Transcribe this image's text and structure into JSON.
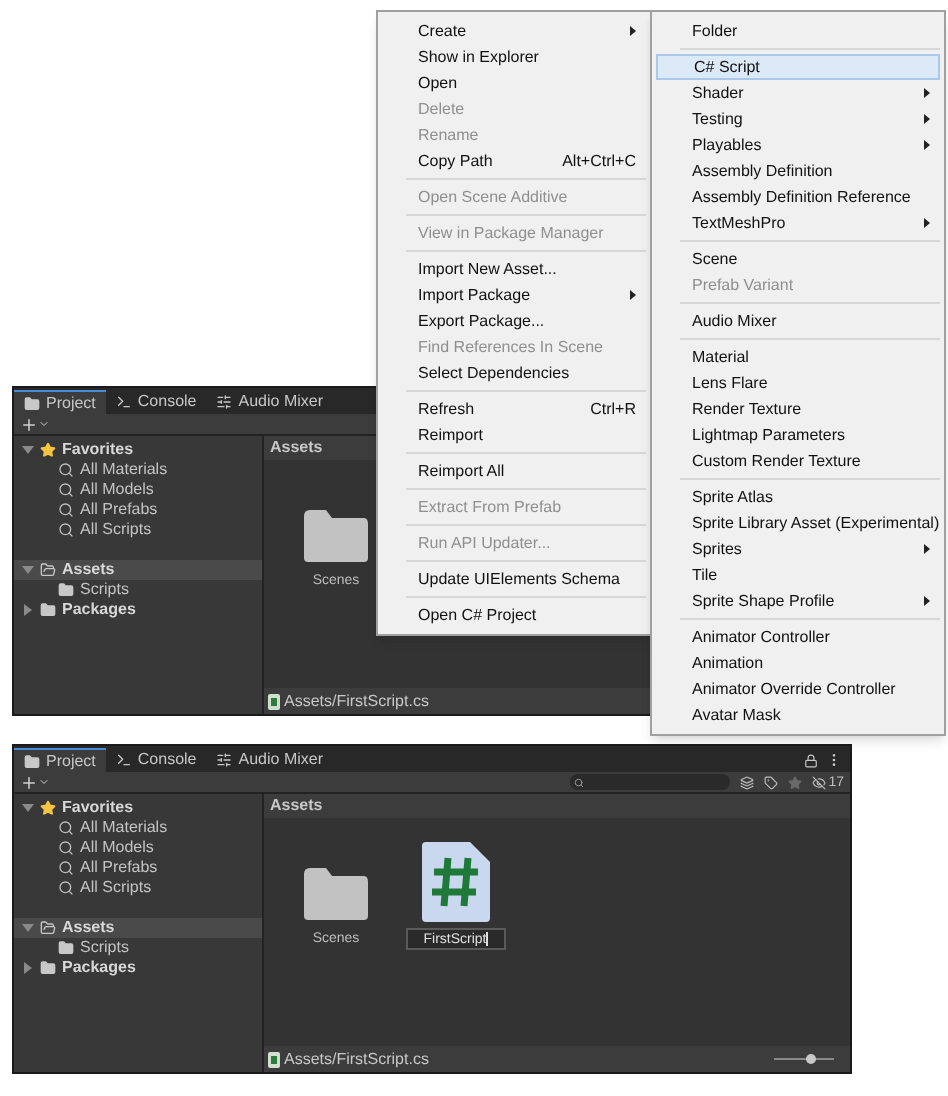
{
  "panels": [
    {
      "tabs": [
        {
          "label": "Project",
          "kind": "project",
          "selected": true
        },
        {
          "label": "Console",
          "kind": "console",
          "selected": false
        },
        {
          "label": "Audio Mixer",
          "kind": "mixer",
          "selected": false
        }
      ],
      "tree": [
        {
          "label": "Favorites",
          "kind": "star",
          "expanded": true,
          "selected": false,
          "children": [
            {
              "label": "All Materials",
              "kind": "search"
            },
            {
              "label": "All Models",
              "kind": "search"
            },
            {
              "label": "All Prefabs",
              "kind": "search"
            },
            {
              "label": "All Scripts",
              "kind": "search"
            }
          ]
        },
        {
          "label": "Assets",
          "kind": "folder",
          "expanded": true,
          "selected": true,
          "children": [
            {
              "label": "Scripts",
              "kind": "folder"
            }
          ]
        },
        {
          "label": "Packages",
          "kind": "folder",
          "expanded": false,
          "selected": false
        }
      ],
      "breadcrumb": "Assets",
      "assets": [
        {
          "kind": "folder",
          "label": "Scenes"
        }
      ],
      "status_path": "Assets/FirstScript.cs"
    },
    {
      "tabs": [
        {
          "label": "Project",
          "kind": "project",
          "selected": true
        },
        {
          "label": "Console",
          "kind": "console",
          "selected": false
        },
        {
          "label": "Audio Mixer",
          "kind": "mixer",
          "selected": false
        }
      ],
      "hidden_count": "17",
      "tree": [
        {
          "label": "Favorites",
          "kind": "star",
          "expanded": true,
          "selected": false,
          "children": [
            {
              "label": "All Materials",
              "kind": "search"
            },
            {
              "label": "All Models",
              "kind": "search"
            },
            {
              "label": "All Prefabs",
              "kind": "search"
            },
            {
              "label": "All Scripts",
              "kind": "search"
            }
          ]
        },
        {
          "label": "Assets",
          "kind": "folder",
          "expanded": true,
          "selected": true,
          "children": [
            {
              "label": "Scripts",
              "kind": "folder"
            }
          ]
        },
        {
          "label": "Packages",
          "kind": "folder",
          "expanded": false,
          "selected": false
        }
      ],
      "breadcrumb": "Assets",
      "assets": [
        {
          "kind": "folder",
          "label": "Scenes"
        },
        {
          "kind": "script",
          "label": "FirstScript",
          "renaming": true
        }
      ],
      "status_path": "Assets/FirstScript.cs",
      "zoom_slider": {
        "level": 0.6
      }
    }
  ],
  "context_menu": {
    "items": [
      {
        "kind": "item",
        "label": "Create",
        "disabled": false,
        "submenu": true
      },
      {
        "kind": "item",
        "label": "Show in Explorer",
        "disabled": false,
        "submenu": false
      },
      {
        "kind": "item",
        "label": "Open",
        "disabled": false,
        "submenu": false
      },
      {
        "kind": "item",
        "label": "Delete",
        "disabled": true,
        "submenu": false
      },
      {
        "kind": "item",
        "label": "Rename",
        "disabled": true,
        "submenu": false
      },
      {
        "kind": "item",
        "label": "Copy Path",
        "shortcut": "Alt+Ctrl+C",
        "disabled": false,
        "submenu": false
      },
      {
        "kind": "separator"
      },
      {
        "kind": "item",
        "label": "Open Scene Additive",
        "disabled": true,
        "submenu": false
      },
      {
        "kind": "separator"
      },
      {
        "kind": "item",
        "label": "View in Package Manager",
        "disabled": true,
        "submenu": false
      },
      {
        "kind": "separator"
      },
      {
        "kind": "item",
        "label": "Import New Asset...",
        "disabled": false,
        "submenu": false
      },
      {
        "kind": "item",
        "label": "Import Package",
        "disabled": false,
        "submenu": true
      },
      {
        "kind": "item",
        "label": "Export Package...",
        "disabled": false,
        "submenu": false
      },
      {
        "kind": "item",
        "label": "Find References In Scene",
        "disabled": true,
        "submenu": false
      },
      {
        "kind": "item",
        "label": "Select Dependencies",
        "disabled": false,
        "submenu": false
      },
      {
        "kind": "separator"
      },
      {
        "kind": "item",
        "label": "Refresh",
        "shortcut": "Ctrl+R",
        "disabled": false,
        "submenu": false
      },
      {
        "kind": "item",
        "label": "Reimport",
        "disabled": false,
        "submenu": false
      },
      {
        "kind": "separator"
      },
      {
        "kind": "item",
        "label": "Reimport All",
        "disabled": false,
        "submenu": false
      },
      {
        "kind": "separator"
      },
      {
        "kind": "item",
        "label": "Extract From Prefab",
        "disabled": true,
        "submenu": false
      },
      {
        "kind": "separator"
      },
      {
        "kind": "item",
        "label": "Run API Updater...",
        "disabled": true,
        "submenu": false
      },
      {
        "kind": "separator"
      },
      {
        "kind": "item",
        "label": "Update UIElements Schema",
        "disabled": false,
        "submenu": false
      },
      {
        "kind": "separator"
      },
      {
        "kind": "item",
        "label": "Open C# Project",
        "disabled": false,
        "submenu": false
      }
    ]
  },
  "create_submenu": {
    "items": [
      {
        "kind": "item",
        "label": "Folder",
        "disabled": false,
        "submenu": false,
        "selected": false
      },
      {
        "kind": "separator"
      },
      {
        "kind": "item",
        "label": "C# Script",
        "disabled": false,
        "submenu": false,
        "selected": true
      },
      {
        "kind": "item",
        "label": "Shader",
        "disabled": false,
        "submenu": true,
        "selected": false
      },
      {
        "kind": "item",
        "label": "Testing",
        "disabled": false,
        "submenu": true,
        "selected": false
      },
      {
        "kind": "item",
        "label": "Playables",
        "disabled": false,
        "submenu": true,
        "selected": false
      },
      {
        "kind": "item",
        "label": "Assembly Definition",
        "disabled": false,
        "submenu": false,
        "selected": false
      },
      {
        "kind": "item",
        "label": "Assembly Definition Reference",
        "disabled": false,
        "submenu": false,
        "selected": false
      },
      {
        "kind": "item",
        "label": "TextMeshPro",
        "disabled": false,
        "submenu": true,
        "selected": false
      },
      {
        "kind": "separator"
      },
      {
        "kind": "item",
        "label": "Scene",
        "disabled": false,
        "submenu": false,
        "selected": false
      },
      {
        "kind": "item",
        "label": "Prefab Variant",
        "disabled": true,
        "submenu": false,
        "selected": false
      },
      {
        "kind": "separator"
      },
      {
        "kind": "item",
        "label": "Audio Mixer",
        "disabled": false,
        "submenu": false,
        "selected": false
      },
      {
        "kind": "separator"
      },
      {
        "kind": "item",
        "label": "Material",
        "disabled": false,
        "submenu": false,
        "selected": false
      },
      {
        "kind": "item",
        "label": "Lens Flare",
        "disabled": false,
        "submenu": false,
        "selected": false
      },
      {
        "kind": "item",
        "label": "Render Texture",
        "disabled": false,
        "submenu": false,
        "selected": false
      },
      {
        "kind": "item",
        "label": "Lightmap Parameters",
        "disabled": false,
        "submenu": false,
        "selected": false
      },
      {
        "kind": "item",
        "label": "Custom Render Texture",
        "disabled": false,
        "submenu": false,
        "selected": false
      },
      {
        "kind": "separator"
      },
      {
        "kind": "item",
        "label": "Sprite Atlas",
        "disabled": false,
        "submenu": false,
        "selected": false
      },
      {
        "kind": "item",
        "label": "Sprite Library Asset (Experimental)",
        "disabled": false,
        "submenu": false,
        "selected": false
      },
      {
        "kind": "item",
        "label": "Sprites",
        "disabled": false,
        "submenu": true,
        "selected": false
      },
      {
        "kind": "item",
        "label": "Tile",
        "disabled": false,
        "submenu": false,
        "selected": false
      },
      {
        "kind": "item",
        "label": "Sprite Shape Profile",
        "disabled": false,
        "submenu": true,
        "selected": false
      },
      {
        "kind": "separator"
      },
      {
        "kind": "item",
        "label": "Animator Controller",
        "disabled": false,
        "submenu": false,
        "selected": false
      },
      {
        "kind": "item",
        "label": "Animation",
        "disabled": false,
        "submenu": false,
        "selected": false
      },
      {
        "kind": "item",
        "label": "Animator Override Controller",
        "disabled": false,
        "submenu": false,
        "selected": false
      },
      {
        "kind": "item",
        "label": "Avatar Mask",
        "disabled": false,
        "submenu": false,
        "selected": false
      }
    ]
  }
}
